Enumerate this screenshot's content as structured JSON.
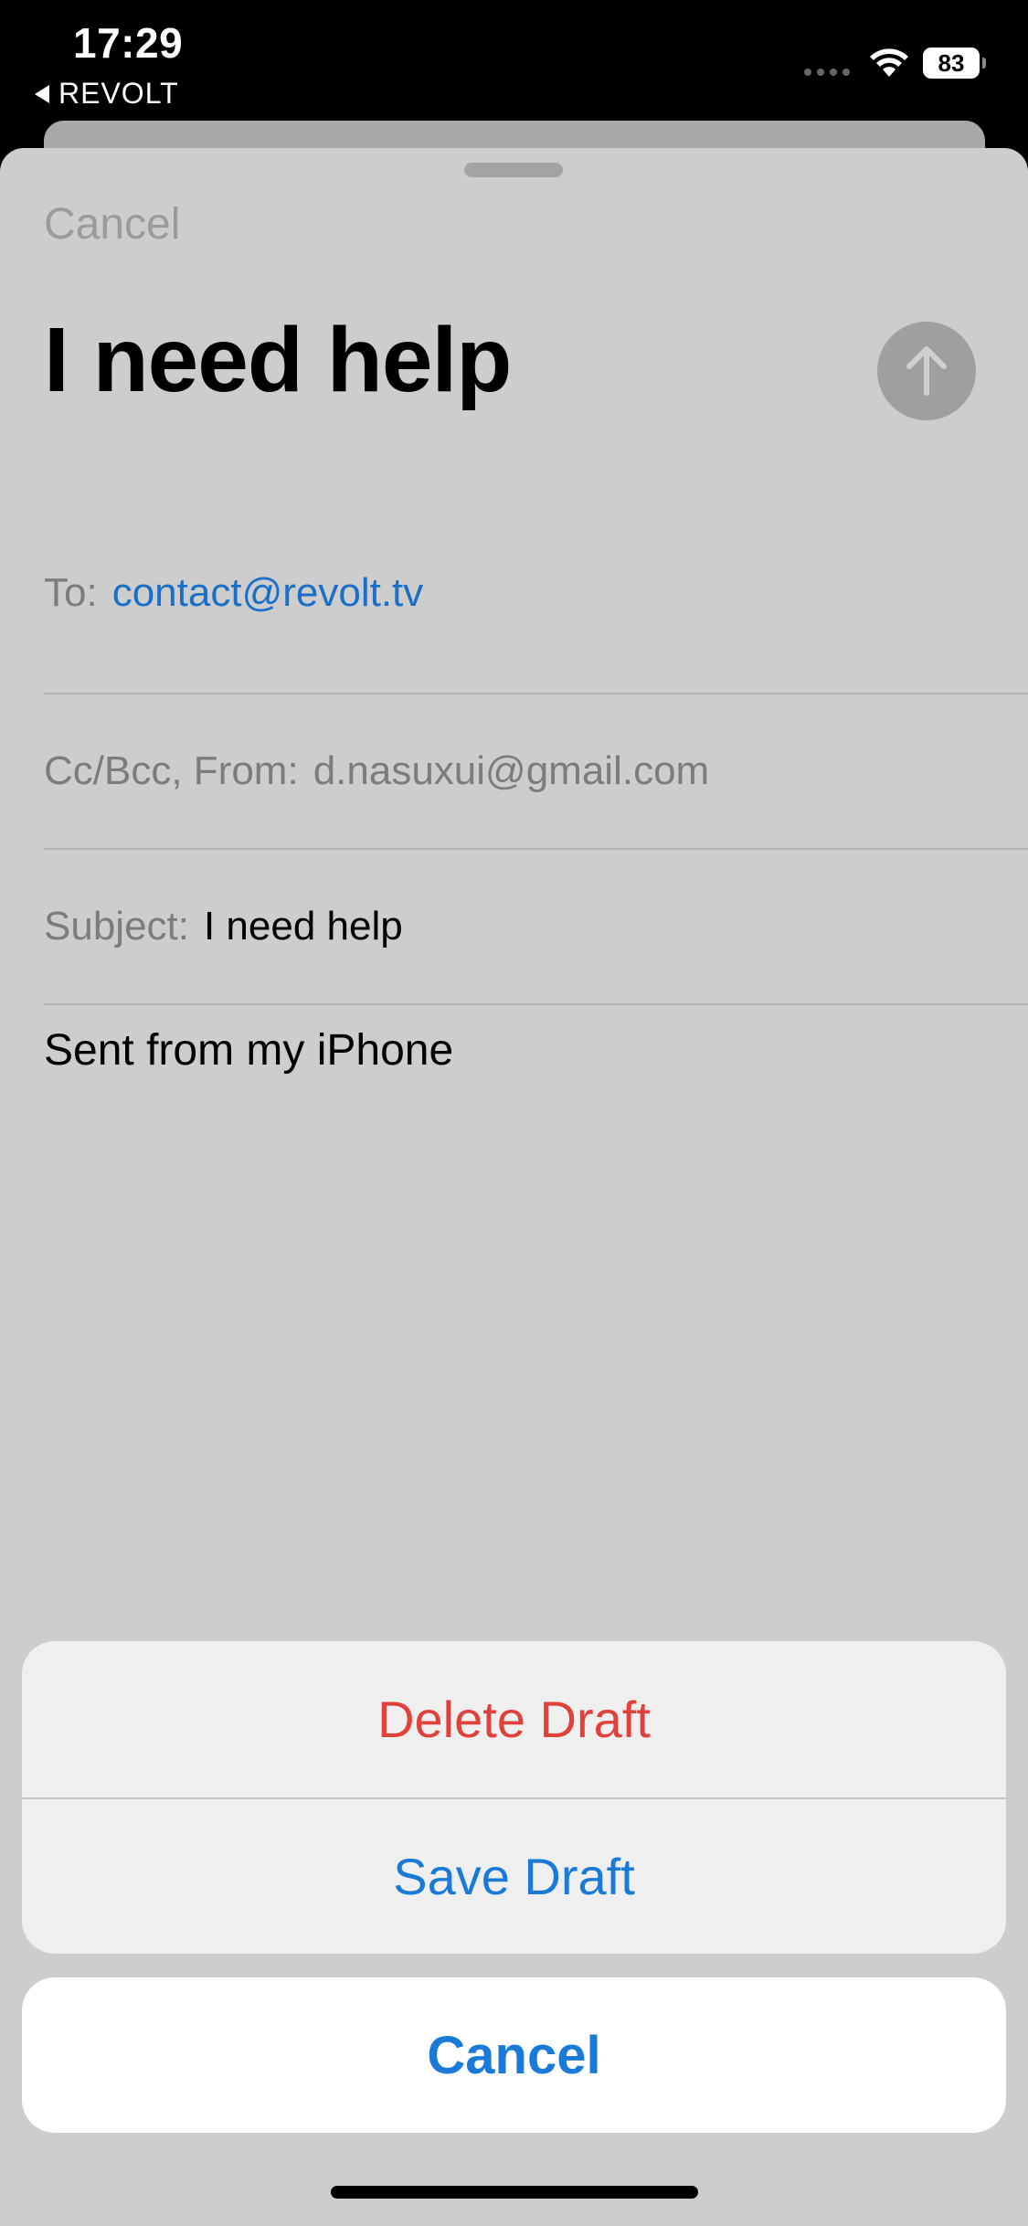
{
  "status_bar": {
    "time": "17:29",
    "back_app": "REVOLT",
    "battery": "83"
  },
  "compose": {
    "cancel_label": "Cancel",
    "title": "I need help",
    "to_label": "To:",
    "to_value": "contact@revolt.tv",
    "cc_label": "Cc/Bcc, From:",
    "cc_value": "d.nasuxui@gmail.com",
    "subject_label": "Subject:",
    "subject_value": "I need help",
    "body": "Sent from my iPhone"
  },
  "action_sheet": {
    "delete_label": "Delete Draft",
    "save_label": "Save Draft",
    "cancel_label": "Cancel"
  },
  "colors": {
    "accent": "#1a7ad8",
    "destructive": "#e0413a",
    "link": "#1a6fc8"
  },
  "icons": {
    "send": "arrow-up-icon",
    "wifi": "wifi-icon",
    "battery": "battery-icon",
    "back": "back-triangle-icon"
  }
}
